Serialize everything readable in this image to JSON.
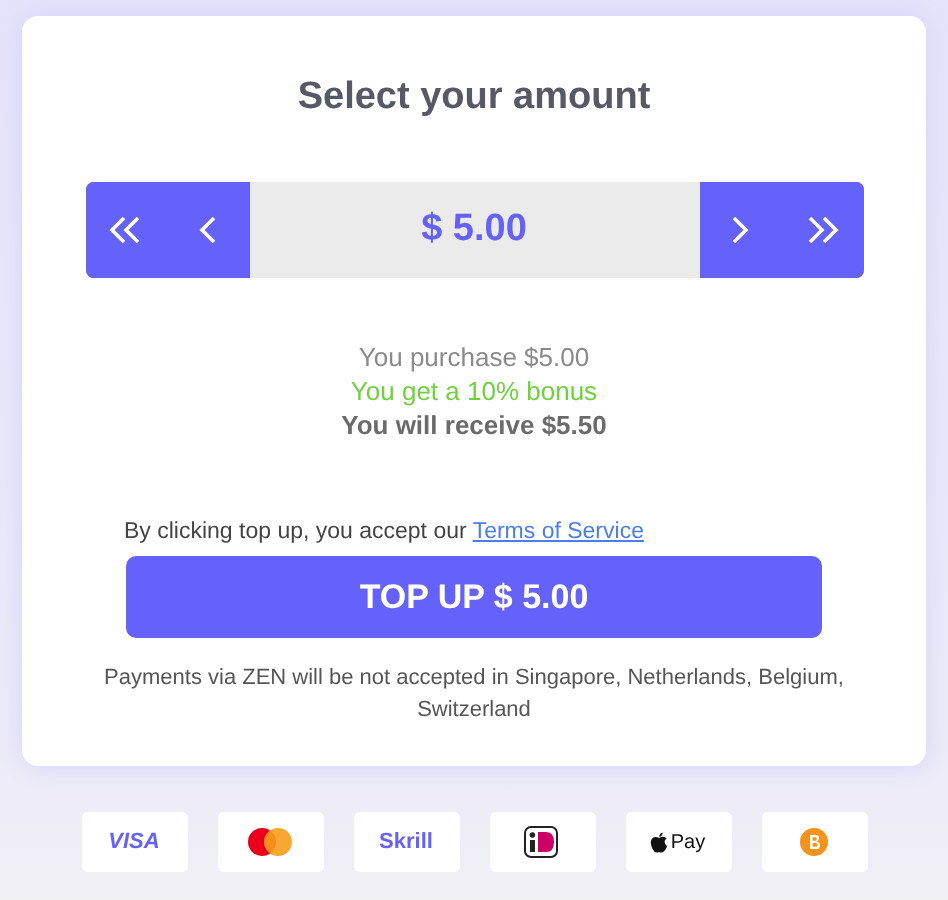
{
  "title": "Select your amount",
  "amount": "$ 5.00",
  "summary": [
    {
      "kind": "plain",
      "text": "You purchase $5.00"
    },
    {
      "kind": "bonus",
      "text": "You get a 10% bonus"
    },
    {
      "kind": "strong",
      "text": "You will receive $5.50"
    }
  ],
  "terms": {
    "text": "By clicking top up, you accept our",
    "link": "Terms of Service"
  },
  "button": "TOP UP $ 5.00",
  "note": "Payments via ZEN will be not accepted in Singapore, Netherlands, Belgium, Switzerland",
  "methods": [
    {
      "kind": "visa",
      "label": "VISA"
    },
    {
      "kind": "mastercard"
    },
    {
      "kind": "skrill",
      "label": "Skrill"
    },
    {
      "kind": "ideal"
    },
    {
      "kind": "applepay",
      "label": "Pay"
    },
    {
      "kind": "bitcoin"
    }
  ]
}
